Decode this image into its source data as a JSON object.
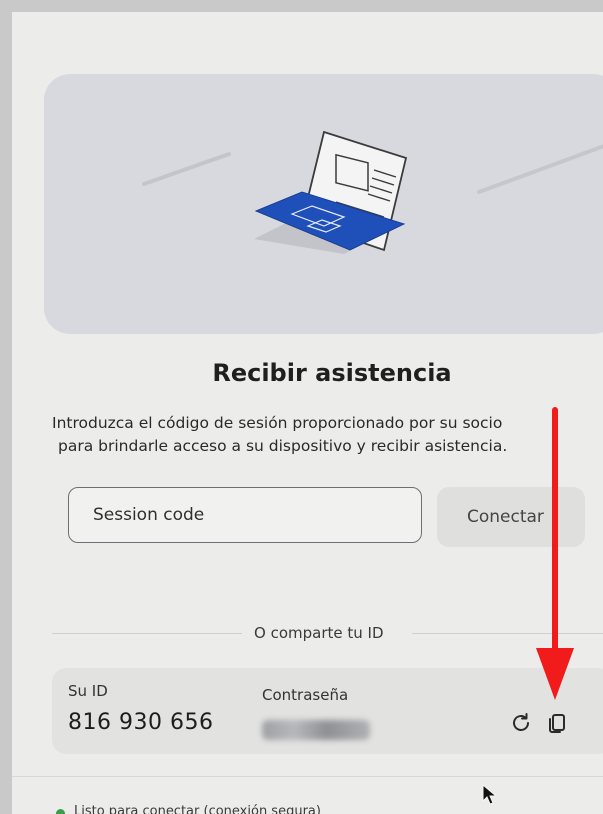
{
  "title": "Recibir asistencia",
  "description": {
    "line1": "Introduzca el código de sesión proporcionado por su socio",
    "line2": "para brindarle acceso a su dispositivo y recibir asistencia."
  },
  "session": {
    "placeholder": "Session code",
    "connect_label": "Conectar"
  },
  "share": {
    "divider_label": "O comparte tu ID"
  },
  "credentials": {
    "id_label": "Su ID",
    "id_value": "816 930 656",
    "password_label": "Contraseña"
  },
  "status": {
    "text": "Listo para conectar (conexión segura)",
    "color": "#3a9d4a"
  },
  "icons": {
    "hero": "laptop-illustration-icon",
    "refresh": "refresh-icon",
    "copy": "copy-icon"
  },
  "colors": {
    "accent_blue": "#1f4fb8",
    "annotation_red": "#f21b1b"
  }
}
